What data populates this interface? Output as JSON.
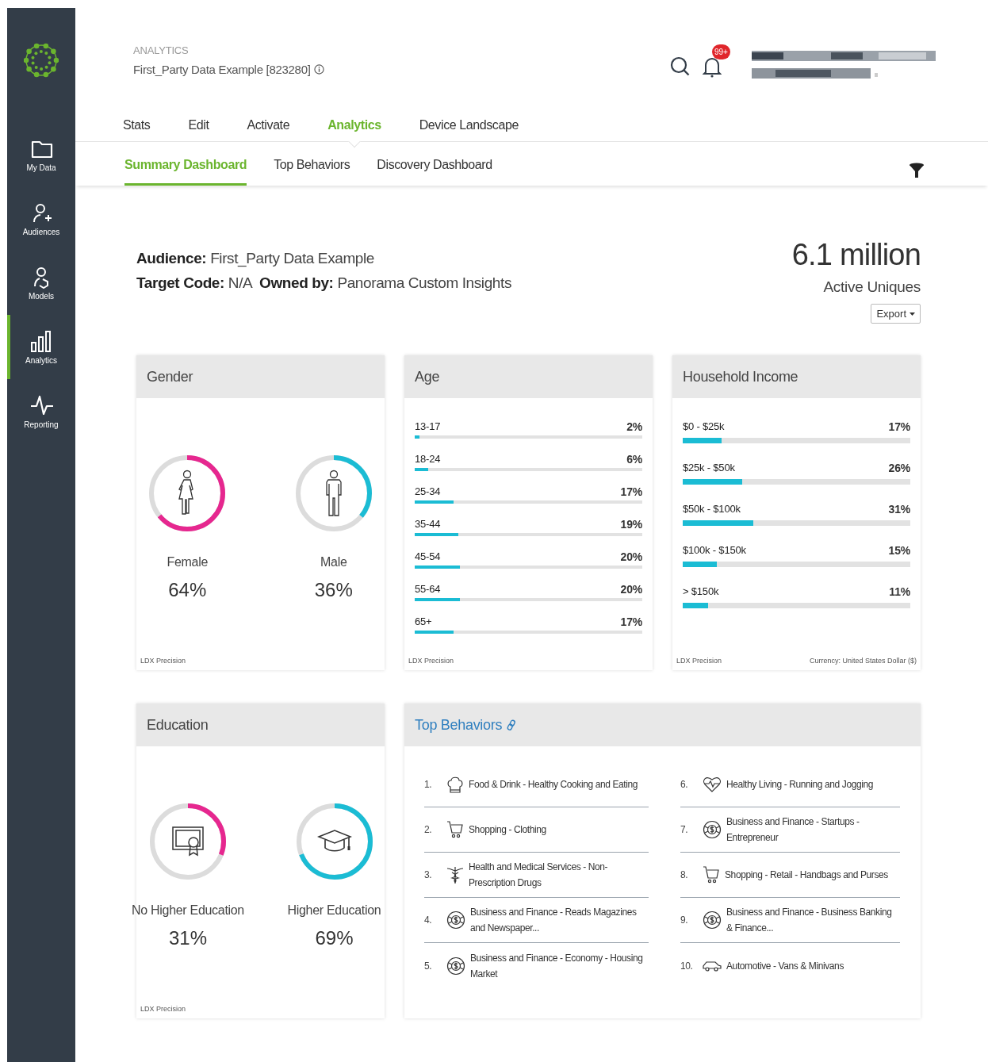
{
  "header": {
    "section": "ANALYTICS",
    "title": "First_Party Data Example [823280]",
    "notification_badge": "99+"
  },
  "sidebar": {
    "items": [
      {
        "label": "My Data",
        "kind": "folder",
        "selected": false
      },
      {
        "label": "Audiences",
        "kind": "user-plus",
        "selected": false
      },
      {
        "label": "Models",
        "kind": "user-model",
        "selected": false
      },
      {
        "label": "Analytics",
        "kind": "bars",
        "selected": true
      },
      {
        "label": "Reporting",
        "kind": "pulse",
        "selected": false
      }
    ]
  },
  "tabs": [
    {
      "label": "Stats",
      "selected": false
    },
    {
      "label": "Edit",
      "selected": false
    },
    {
      "label": "Activate",
      "selected": false
    },
    {
      "label": "Analytics",
      "selected": true
    },
    {
      "label": "Device Landscape",
      "selected": false
    }
  ],
  "subtabs": [
    {
      "label": "Summary Dashboard",
      "selected": true
    },
    {
      "label": "Top Behaviors",
      "selected": false
    },
    {
      "label": "Discovery Dashboard",
      "selected": false
    }
  ],
  "audience": {
    "line_1": "**Audience:** First_Party Data Example",
    "line_2": "**Target Code:** N/A  **Owned by:** Panorama Custom Insights"
  },
  "summary": {
    "count": "6.1 million",
    "label": "Active Uniques",
    "export_button": "Export"
  },
  "gender": {
    "title": "Gender",
    "footer": "LDX Precision",
    "segments": [
      {
        "label": "Female",
        "value": "64%",
        "level": 0.64,
        "color": "#e6278f",
        "kind": "female"
      },
      {
        "label": "Male",
        "value": "36%",
        "level": 0.36,
        "color": "#1bbcd4",
        "kind": "male"
      }
    ]
  },
  "age": {
    "title": "Age",
    "footer": "LDX Precision",
    "rows": [
      {
        "label": "13-17",
        "value": "2%",
        "level": 0.02
      },
      {
        "label": "18-24",
        "value": "6%",
        "level": 0.06
      },
      {
        "label": "25-34",
        "value": "17%",
        "level": 0.17
      },
      {
        "label": "35-44",
        "value": "19%",
        "level": 0.19
      },
      {
        "label": "45-54",
        "value": "20%",
        "level": 0.2
      },
      {
        "label": "55-64",
        "value": "20%",
        "level": 0.2
      },
      {
        "label": "65+",
        "value": "17%",
        "level": 0.17
      }
    ]
  },
  "household_income": {
    "title": "Household Income",
    "footer": "LDX Precision",
    "currency_note": "Currency: United States Dollar ($)",
    "rows": [
      {
        "label": "$0 - $25k",
        "value": "17%",
        "level": 0.17
      },
      {
        "label": "$25k - $50k",
        "value": "26%",
        "level": 0.26
      },
      {
        "label": "$50k - $100k",
        "value": "31%",
        "level": 0.31
      },
      {
        "label": "$100k - $150k",
        "value": "15%",
        "level": 0.15
      },
      {
        "label": "> $150k",
        "value": "11%",
        "level": 0.11
      }
    ]
  },
  "education": {
    "title": "Education",
    "footer": "LDX Precision",
    "segments": [
      {
        "label": "No Higher Education",
        "value": "31%",
        "level": 0.31,
        "color": "#e6278f",
        "kind": "certificate"
      },
      {
        "label": "Higher Education",
        "value": "69%",
        "level": 0.69,
        "color": "#1bbcd4",
        "kind": "graduation-cap"
      }
    ]
  },
  "top_behaviors": {
    "title": "Top Behaviors",
    "items": [
      {
        "rank": "1.",
        "label": "Food & Drink - Healthy Cooking and Eating",
        "kind": "chef-hat"
      },
      {
        "rank": "2.",
        "label": "Shopping - Clothing",
        "kind": "cart"
      },
      {
        "rank": "3.",
        "label": "Health and Medical Services - Non-Prescription Drugs",
        "kind": "caduceus"
      },
      {
        "rank": "4.",
        "label": "Business and Finance - Reads Magazines and Newspaper...",
        "kind": "finance"
      },
      {
        "rank": "5.",
        "label": "Business and Finance - Economy - Housing Market",
        "kind": "finance"
      },
      {
        "rank": "6.",
        "label": "Healthy Living - Running and Jogging",
        "kind": "heart"
      },
      {
        "rank": "7.",
        "label": "Business and Finance - Startups - Entrepreneur",
        "kind": "finance"
      },
      {
        "rank": "8.",
        "label": "Shopping - Retail - Handbags and Purses",
        "kind": "cart"
      },
      {
        "rank": "9.",
        "label": "Business and Finance - Business Banking & Finance...",
        "kind": "finance"
      },
      {
        "rank": "10.",
        "label": "Automotive - Vans & Minivans",
        "kind": "car"
      }
    ]
  }
}
